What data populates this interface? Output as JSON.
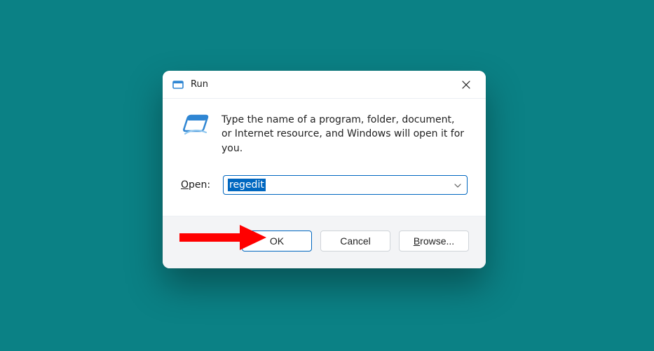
{
  "dialog": {
    "title": "Run",
    "description": "Type the name of a program, folder, document, or Internet resource, and Windows will open it for you.",
    "open_label_prefix": "O",
    "open_label_rest": "pen:",
    "input_value": "regedit",
    "buttons": {
      "ok": "OK",
      "cancel": "Cancel",
      "browse_prefix": "B",
      "browse_rest": "rowse..."
    }
  },
  "colors": {
    "accent": "#0067c0",
    "desktop": "#0b8185",
    "arrow": "#ff0000"
  }
}
